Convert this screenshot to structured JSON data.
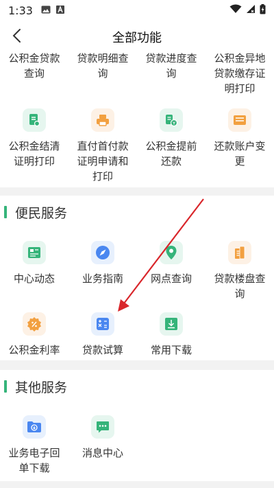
{
  "status": {
    "time": "1:33"
  },
  "header": {
    "title": "全部功能"
  },
  "section1": {
    "rows": [
      [
        "公积金贷款查询",
        "贷款明细查询",
        "贷款进度查询",
        "公积金异地贷款缴存证明打印"
      ],
      [
        "公积金结清证明打印",
        "直付首付款证明申请和打印",
        "公积金提前还款",
        "还款账户变更"
      ]
    ]
  },
  "section2": {
    "title": "便民服务",
    "items": [
      "中心动态",
      "业务指南",
      "网点查询",
      "贷款楼盘查询",
      "公积金利率",
      "贷款试算",
      "常用下载"
    ]
  },
  "section3": {
    "title": "其他服务",
    "items": [
      "业务电子回单下载",
      "消息中心"
    ]
  },
  "colors": {
    "accent": "#35b47a",
    "blue": "#4a87f0",
    "orange": "#f2a040",
    "arrow": "#d9262b"
  }
}
